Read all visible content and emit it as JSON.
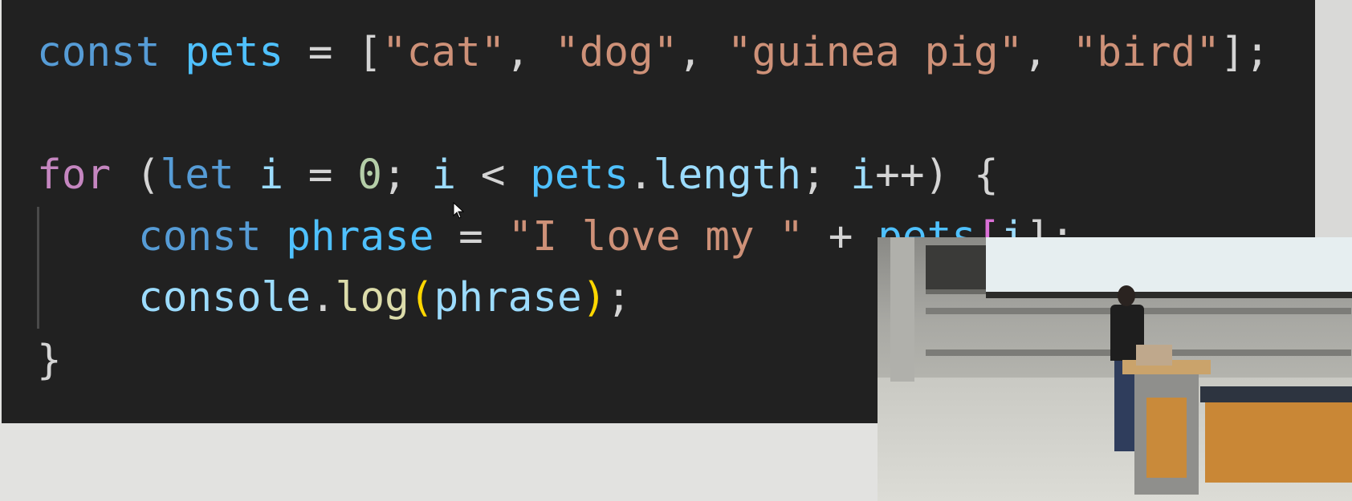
{
  "code": {
    "line1": {
      "kw_const": "const",
      "var_pets": "pets",
      "assign": " = ",
      "open_bracket": "[",
      "str_cat": "\"cat\"",
      "comma1": ", ",
      "str_dog": "\"dog\"",
      "comma2": ", ",
      "str_guinea": "\"guinea pig\"",
      "comma3": ", ",
      "str_bird": "\"bird\"",
      "close": "];"
    },
    "line3": {
      "kw_for": "for",
      "open_paren": " (",
      "kw_let": "let",
      "var_i": " i",
      "assign": " = ",
      "num_zero": "0",
      "semi1": "; ",
      "var_i2": "i",
      "lt": " < ",
      "ident_pets": "pets",
      "dot": ".",
      "ident_length": "length",
      "semi2": "; ",
      "var_i3": "i",
      "incr": "++",
      "close_paren": ")",
      "open_brace": " {"
    },
    "line4": {
      "kw_const": "const",
      "var_phrase": " phrase",
      "assign": " = ",
      "str_love": "\"I love my \"",
      "plus": " + ",
      "ident_pets": "pets",
      "bracket_open": "[",
      "ident_i": "i",
      "bracket_close": "];"
    },
    "line5": {
      "ident_console": "console",
      "dot": ".",
      "fn_log": "log",
      "paren_open": "(",
      "ident_phrase": "phrase",
      "paren_close": ")",
      "semi": ";"
    },
    "line6": {
      "close_brace": "}"
    }
  },
  "colors": {
    "editor_background": "#212121",
    "keyword_storage": "#569cd6",
    "keyword_control": "#c586c0",
    "constant_variable": "#4fc1ff",
    "identifier": "#9cdcfe",
    "string": "#ce9178",
    "number": "#b5cea8",
    "function": "#dcdcaa"
  },
  "icons": {
    "mouse_cursor": "arrow-pointer-icon"
  },
  "camera_feed": {
    "description_icon": "video-feed"
  }
}
